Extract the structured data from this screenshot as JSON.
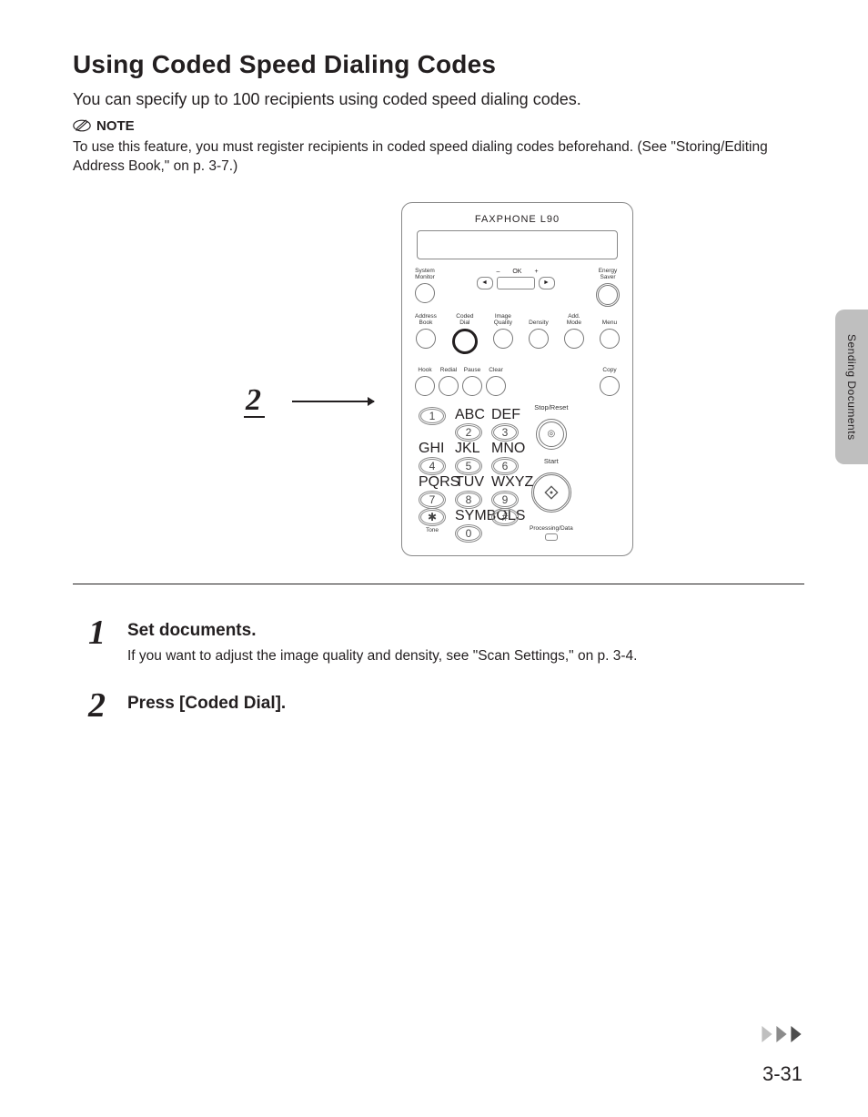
{
  "section": {
    "heading": "Using Coded Speed Dialing Codes",
    "intro": "You can specify up to 100 recipients using coded speed dialing codes.",
    "note_label": "NOTE",
    "note_text_pre": "To use this feature, you must register recipients in coded speed dialing codes beforehand. (See \"",
    "note_link": "Storing/Editing Address Book",
    "note_text_post": ",\" on p. 3-7.)"
  },
  "figure": {
    "callout_number": "2",
    "device_name": "FAXPHONE L90",
    "labels": {
      "system_monitor": "System\nMonitor",
      "minus": "–",
      "ok": "OK",
      "plus": "+",
      "energy_saver": "Energy\nSaver",
      "address_book": "Address\nBook",
      "coded_dial": "Coded\nDial",
      "image_quality": "Image\nQuality",
      "density": "Density",
      "add_mode": "Add.\nMode",
      "menu": "Menu",
      "hook": "Hook",
      "redial": "Redial",
      "pause": "Pause",
      "clear": "Clear",
      "copy": "Copy",
      "stop_reset": "Stop/Reset",
      "start": "Start",
      "processing": "Processing/Data",
      "tone": "Tone",
      "symbols": "SYMBOLS"
    },
    "key_letters": {
      "2": "ABC",
      "3": "DEF",
      "4": "GHI",
      "5": "JKL",
      "6": "MNO",
      "7": "PQRS",
      "8": "TUV",
      "9": "WXYZ"
    },
    "keys": [
      "1",
      "2",
      "3",
      "4",
      "5",
      "6",
      "7",
      "8",
      "9",
      "✱",
      "0",
      "#"
    ]
  },
  "steps": [
    {
      "num": "1",
      "title": "Set documents.",
      "desc_pre": "If you want to adjust the image quality and density, see \"",
      "link": "Scan Settings",
      "desc_post": ",\" on p. 3-4."
    },
    {
      "num": "2",
      "title": "Press [Coded Dial].",
      "desc_pre": "",
      "link": "",
      "desc_post": ""
    }
  ],
  "side_tab": "Sending Documents",
  "page_number": "3-31"
}
